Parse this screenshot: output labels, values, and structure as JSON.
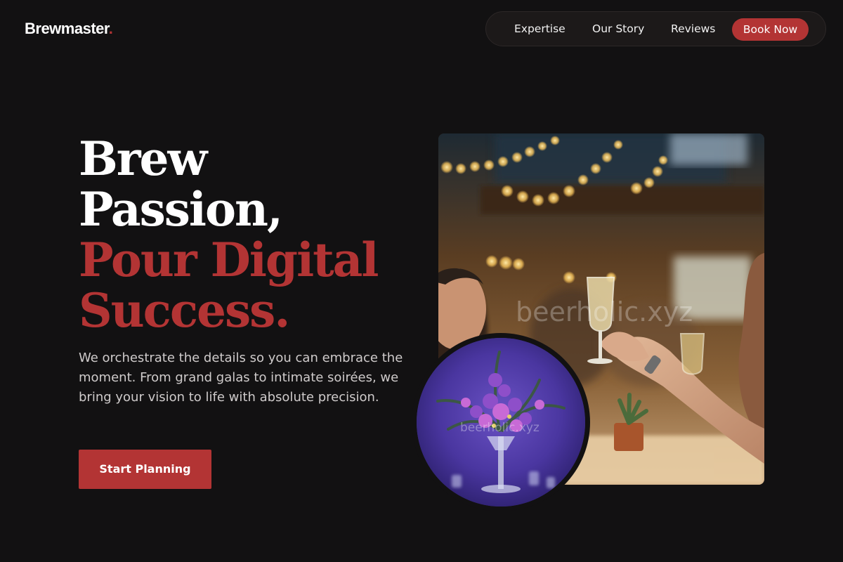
{
  "brand": {
    "name": "Brewmaster",
    "dot": ".",
    "accent_color": "#b33434",
    "background_color": "#121112"
  },
  "nav": {
    "links": [
      "Expertise",
      "Our Story",
      "Reviews"
    ],
    "cta_label": "Book Now"
  },
  "hero": {
    "headline_white": [
      "Brew",
      "Passion,"
    ],
    "headline_red": [
      "Pour Digital",
      "Success."
    ],
    "subtext": "We orchestrate the details so you can embrace the moment. From grand galas to intimate soirées, we bring your vision to life with absolute precision.",
    "cta_label": "Start Planning"
  },
  "images": {
    "main": {
      "subject": "guests raising champagne glasses in a string-lit hall",
      "watermark": "beerholic.xyz"
    },
    "circle": {
      "subject": "purple floral centerpiece in a tall glass vase",
      "watermark": "beerholic.xyz"
    }
  }
}
